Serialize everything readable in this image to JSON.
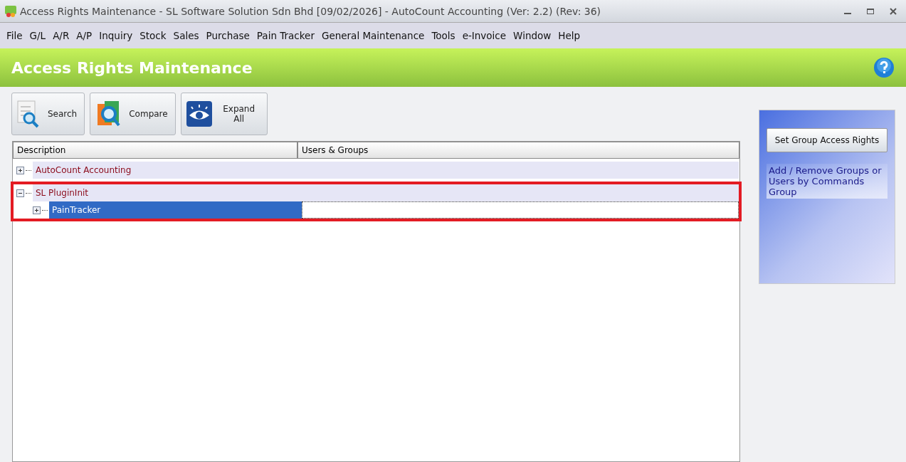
{
  "window": {
    "title": "Access Rights Maintenance - SL Software Solution Sdn Bhd [09/02/2026] - AutoCount Accounting (Ver: 2.2) (Rev: 36)"
  },
  "menu": [
    "File",
    "G/L",
    "A/R",
    "A/P",
    "Inquiry",
    "Stock",
    "Sales",
    "Purchase",
    "Pain Tracker",
    "General Maintenance",
    "Tools",
    "e-Invoice",
    "Window",
    "Help"
  ],
  "header": {
    "title": "Access Rights Maintenance"
  },
  "toolbar": [
    {
      "kind": "search",
      "label": "Search"
    },
    {
      "kind": "compare",
      "label": "Compare"
    },
    {
      "kind": "expand",
      "label": "Expand All"
    }
  ],
  "tree": {
    "columns": [
      "Description",
      "Users & Groups"
    ],
    "items": [
      {
        "label": "AutoCount Accounting",
        "expanded": false,
        "selected": false,
        "highlighted": false
      },
      {
        "label": "SL PluginInit",
        "expanded": true,
        "selected": false,
        "highlighted": true,
        "children": [
          {
            "label": "PainTracker",
            "expanded": false,
            "selected": true
          }
        ]
      }
    ]
  },
  "side_panel": {
    "button": "Set Group Access Rights",
    "description": "Add / Remove Groups or Users by Commands Group"
  }
}
